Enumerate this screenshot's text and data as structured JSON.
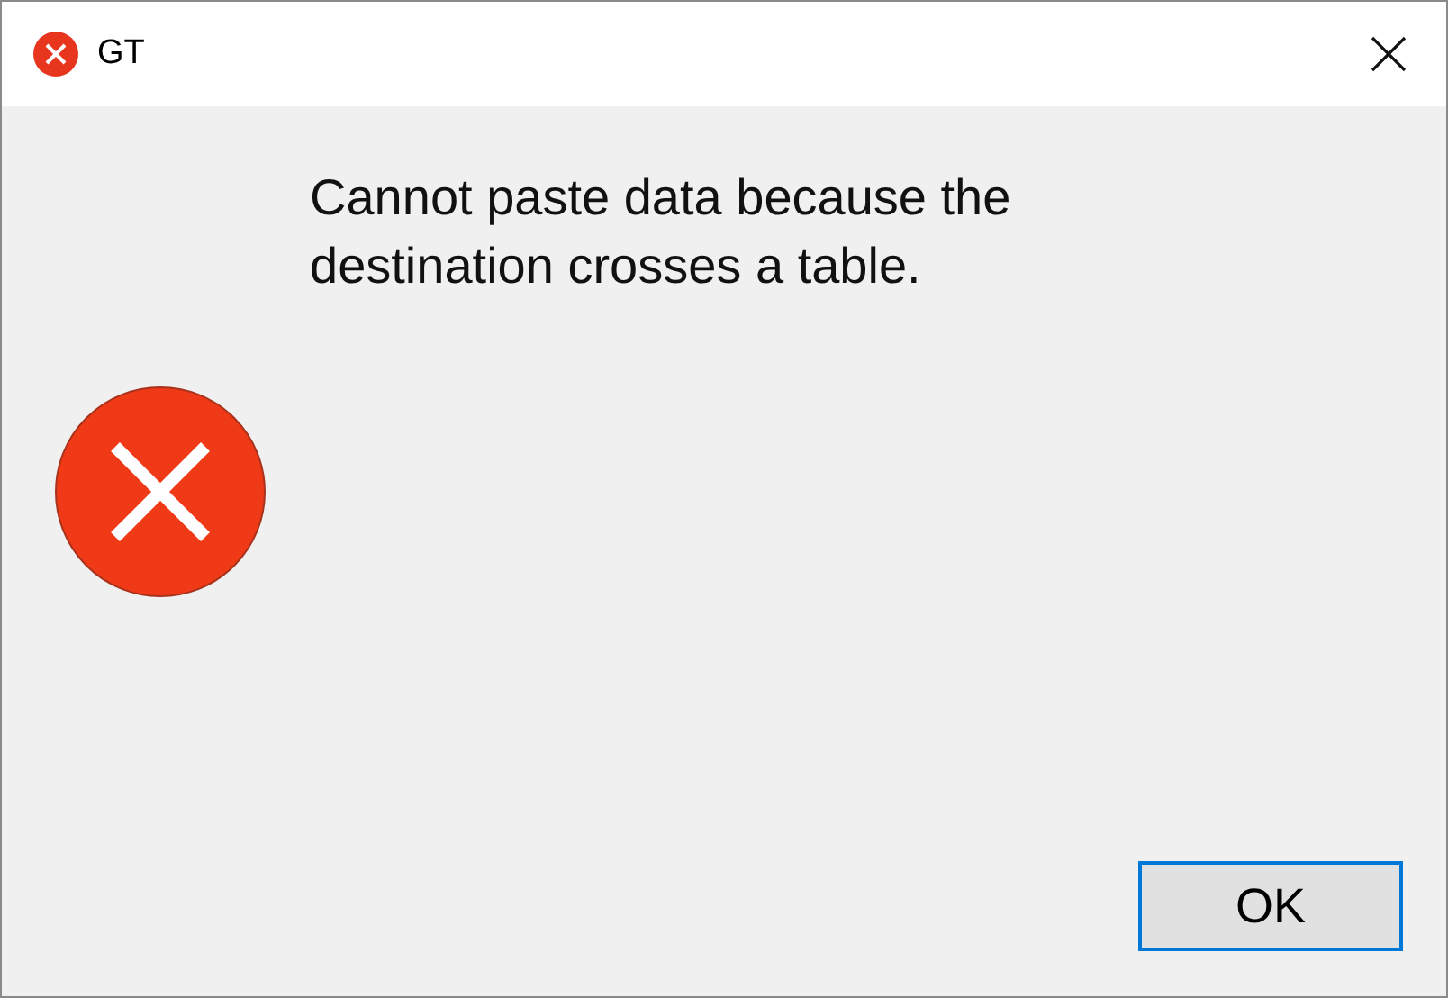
{
  "window": {
    "title": "GT"
  },
  "message": "Cannot paste data because the destination crosses a table.",
  "buttons": [
    {
      "label": "OK",
      "default": true
    }
  ]
}
